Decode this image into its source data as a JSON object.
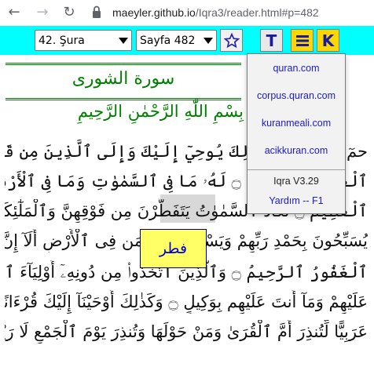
{
  "browser": {
    "url_host": "maeyler.github.io",
    "url_path": "/Iqra3/reader.html#p=482"
  },
  "toolbar": {
    "sura_selected": "42. Şura",
    "page_selected": "Sayfa 482",
    "t_label": "T",
    "k_label": "K"
  },
  "menu": {
    "links": [
      "quran.com",
      "corpus.quran.com",
      "kuranmeali.com",
      "acikkuran.com"
    ],
    "version": "Iqra V3.29",
    "help": "Yardım -- F1"
  },
  "page": {
    "sura_title": "سورة الشورى",
    "basmala": "بِسْمِ اللّٰهِ الرَّحْمٰنِ الرَّحِيمِ",
    "lines": [
      "حمٓ ۝ عٓسٓقٓ ۝ كَذٰلِكَ يُوحِيٓ إِلَيْكَ وَإِلَى ٱلَّذِينَ مِن قَبْلِكَ ٱللَّهُ",
      "ٱلْعَزِيزُ ٱلْحَكِيمُ ۝ لَهُۥ مَا فِى ٱلسَّمٰوٰتِ وَمَا فِى ٱلْأَرْضِ وَهُوَ ٱلْعَلِىُّ",
      "ٱلْعَظِيمُ ۝ تَكَادُ ٱلسَّمٰوٰتُ يَتَفَطَّرْنَ مِن فَوْقِهِنَّ وَٱلْمَلٰٓئِكَةُ",
      "يُسَبِّحُونَ بِحَمْدِ رَبِّهِمْ وَيَسْتَغْفِرُونَ لِمَن فِى ٱلْأَرْضِ أَلَآ إِنَّ ٱللَّهَ هُوَ",
      "ٱلْغَفُورُ ٱلرَّحِيمُ ۝ وَٱلَّذِينَ ٱتَّخَذُوا۟ مِن دُونِهِۦٓ أَوْلِيَآءَ ٱللَّهُ حَفِيظٌ",
      "عَلَيْهِمْ وَمَآ أَنتَ عَلَيْهِم بِوَكِيلٍ ۝ وَكَذٰلِكَ أَوْحَيْنَآ إِلَيْكَ قُرْءَانًا",
      "عَرَبِيًّا لِّتُنذِرَ أُمَّ ٱلْقُرَىٰ وَمَنْ حَوْلَهَا وَتُنذِرَ يَوْمَ ٱلْجَمْعِ لَا رَيْبَ فِيهِ"
    ],
    "root_word": "فطر"
  }
}
